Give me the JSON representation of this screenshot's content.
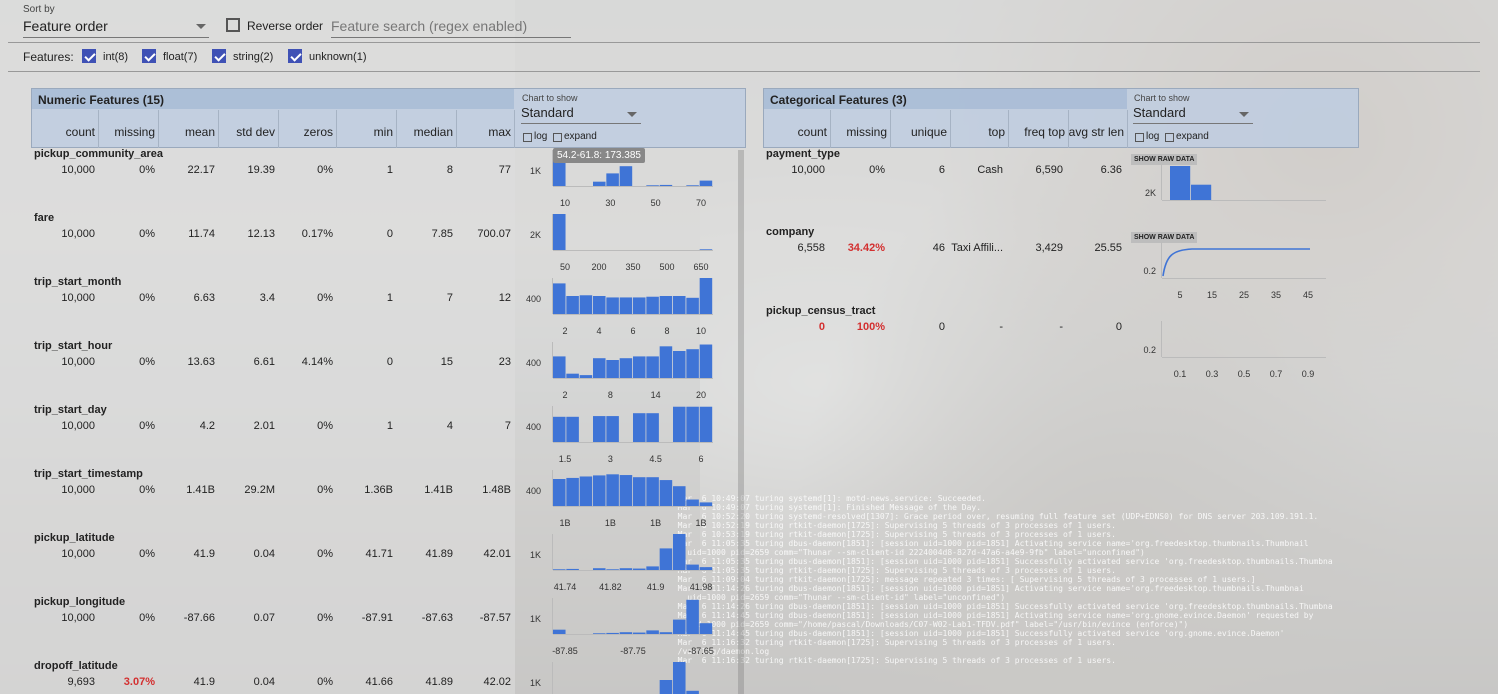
{
  "controls": {
    "sort_label": "Sort by",
    "sort_value": "Feature order",
    "reverse_label": "Reverse order",
    "search_placeholder": "Feature search (regex enabled)",
    "features_label": "Features:",
    "feature_types": [
      {
        "label": "int(8)",
        "checked": true
      },
      {
        "label": "float(7)",
        "checked": true
      },
      {
        "label": "string(2)",
        "checked": true
      },
      {
        "label": "unknown(1)",
        "checked": true
      }
    ]
  },
  "numeric": {
    "title": "Numeric Features (15)",
    "chart_label": "Chart to show",
    "chart_value": "Standard",
    "log_label": "log",
    "expand_label": "expand",
    "columns": [
      "count",
      "missing",
      "mean",
      "std dev",
      "zeros",
      "min",
      "median",
      "max"
    ],
    "tooltip": "54.2-61.8: 173.385",
    "rows": [
      {
        "name": "pickup_community_area",
        "count": "10,000",
        "missing": "0%",
        "mean": "22.17",
        "std": "19.39",
        "zeros": "0%",
        "min": "1",
        "median": "8",
        "max": "77",
        "missing_red": false,
        "ylabel": "1K",
        "ticks": [
          "10",
          "30",
          "50",
          "70"
        ],
        "bars": [
          0.95,
          0,
          0,
          0.12,
          0.35,
          0.55,
          0,
          0.02,
          0.03,
          0,
          0.02,
          0.15
        ]
      },
      {
        "name": "fare",
        "count": "10,000",
        "missing": "0%",
        "mean": "11.74",
        "std": "12.13",
        "zeros": "0.17%",
        "min": "0",
        "median": "7.85",
        "max": "700.07",
        "missing_red": false,
        "ylabel": "2K",
        "ticks": [
          "50",
          "200",
          "350",
          "500",
          "650"
        ],
        "bars": [
          1,
          0,
          0,
          0,
          0,
          0,
          0,
          0,
          0,
          0,
          0,
          0.02
        ]
      },
      {
        "name": "trip_start_month",
        "count": "10,000",
        "missing": "0%",
        "mean": "6.63",
        "std": "3.4",
        "zeros": "0%",
        "min": "1",
        "median": "7",
        "max": "12",
        "missing_red": false,
        "ylabel": "400",
        "ticks": [
          "2",
          "4",
          "6",
          "8",
          "10"
        ],
        "bars": [
          0.85,
          0.5,
          0.52,
          0.5,
          0.46,
          0.46,
          0.46,
          0.48,
          0.5,
          0.5,
          0.45,
          1
        ]
      },
      {
        "name": "trip_start_hour",
        "count": "10,000",
        "missing": "0%",
        "mean": "13.63",
        "std": "6.61",
        "zeros": "4.14%",
        "min": "0",
        "median": "15",
        "max": "23",
        "missing_red": false,
        "ylabel": "400",
        "ticks": [
          "2",
          "8",
          "14",
          "20"
        ],
        "bars": [
          0.6,
          0.12,
          0.08,
          0.55,
          0.5,
          0.55,
          0.6,
          0.6,
          0.88,
          0.75,
          0.8,
          0.93
        ]
      },
      {
        "name": "trip_start_day",
        "count": "10,000",
        "missing": "0%",
        "mean": "4.2",
        "std": "2.01",
        "zeros": "0%",
        "min": "1",
        "median": "4",
        "max": "7",
        "missing_red": false,
        "ylabel": "400",
        "ticks": [
          "1.5",
          "3",
          "4.5",
          "6"
        ],
        "bars": [
          0.7,
          0.7,
          0,
          0.72,
          0.72,
          0,
          0.8,
          0.8,
          0,
          0.98,
          0.98,
          0.98
        ]
      },
      {
        "name": "trip_start_timestamp",
        "count": "10,000",
        "missing": "0%",
        "mean": "1.41B",
        "std": "29.2M",
        "zeros": "0%",
        "min": "1.36B",
        "median": "1.41B",
        "max": "1.48B",
        "missing_red": false,
        "ylabel": "400",
        "ticks": [
          "1B",
          "1B",
          "1B",
          "1B"
        ],
        "bars": [
          0.75,
          0.78,
          0.82,
          0.85,
          0.88,
          0.86,
          0.8,
          0.8,
          0.72,
          0.55,
          0.18,
          0.1
        ]
      },
      {
        "name": "pickup_latitude",
        "count": "10,000",
        "missing": "0%",
        "mean": "41.9",
        "std": "0.04",
        "zeros": "0%",
        "min": "41.71",
        "median": "41.89",
        "max": "42.01",
        "missing_red": false,
        "ylabel": "1K",
        "ticks": [
          "41.74",
          "41.82",
          "41.9",
          "41.98"
        ],
        "bars": [
          0.02,
          0.03,
          0,
          0.05,
          0.02,
          0.05,
          0.04,
          0.1,
          0.6,
          1,
          0.15,
          0.08
        ]
      },
      {
        "name": "pickup_longitude",
        "count": "10,000",
        "missing": "0%",
        "mean": "-87.66",
        "std": "0.07",
        "zeros": "0%",
        "min": "-87.91",
        "median": "-87.63",
        "max": "-87.57",
        "missing_red": false,
        "ylabel": "1K",
        "ticks": [
          "-87.85",
          "-87.75",
          "-87.65"
        ],
        "bars": [
          0.12,
          0,
          0,
          0.02,
          0.03,
          0.05,
          0.04,
          0.1,
          0.05,
          0.4,
          0.95,
          0.3
        ]
      },
      {
        "name": "dropoff_latitude",
        "count": "9,693",
        "missing": "3.07%",
        "mean": "41.9",
        "std": "0.04",
        "zeros": "0%",
        "min": "41.66",
        "median": "41.89",
        "max": "42.02",
        "missing_red": true,
        "ylabel": "1K",
        "ticks": [],
        "bars": [
          0,
          0,
          0,
          0,
          0,
          0,
          0,
          0,
          0.5,
          1,
          0.2,
          0.05
        ]
      }
    ]
  },
  "categorical": {
    "title": "Categorical Features (3)",
    "chart_label": "Chart to show",
    "chart_value": "Standard",
    "log_label": "log",
    "expand_label": "expand",
    "columns": [
      "count",
      "missing",
      "unique",
      "top",
      "freq top",
      "avg str len"
    ],
    "raw_button": "SHOW RAW DATA",
    "rows": [
      {
        "name": "payment_type",
        "count": "10,000",
        "missing": "0%",
        "unique": "6",
        "top": "Cash",
        "freq_top": "6,590",
        "avg_len": "6.36",
        "count_red": false,
        "missing_red": false,
        "ylabel": "2K",
        "ticks": [],
        "bars": [
          0,
          1,
          0.45,
          0,
          0,
          0,
          0,
          0
        ],
        "kind": "bar",
        "raw": true
      },
      {
        "name": "company",
        "count": "6,558",
        "missing": "34.42%",
        "unique": "46",
        "top": "Taxi Affili...",
        "freq_top": "3,429",
        "avg_len": "25.55",
        "count_red": false,
        "missing_red": true,
        "ylabel": "0.2",
        "ticks": [
          "5",
          "15",
          "25",
          "35",
          "45"
        ],
        "kind": "cdf",
        "raw": true
      },
      {
        "name": "pickup_census_tract",
        "count": "0",
        "missing": "100%",
        "unique": "0",
        "top": "-",
        "freq_top": "-",
        "avg_len": "0",
        "count_red": true,
        "missing_red": true,
        "ylabel": "0.2",
        "ticks": [
          "0.1",
          "0.3",
          "0.5",
          "0.7",
          "0.9"
        ],
        "kind": "empty",
        "raw": false
      }
    ]
  },
  "terminal": {
    "lines": [
      "  Mar  6 10:49:07 turing systemd[1]: motd-news.service: Succeeded.",
      "  Mar  6 10:49:07 turing systemd[1]: Finished Message of the Day.",
      "  Mar  6 10:52:20 turing systemd-resolved[1307]: Grace period over, resuming full feature set (UDP+EDNS0) for DNS server 203.109.191.1.",
      "  Mar  6 10:52:19 turing rtkit-daemon[1725]: Supervising 5 threads of 3 processes of 1 users.",
      "  Mar  6 10:53:19 turing rtkit-daemon[1725]: Supervising 5 threads of 3 processes of 1 users.",
      "  Mar  6 11:05:35 turing dbus-daemon[1851]: [session uid=1000 pid=1851] Activating service name='org.freedesktop.thumbnails.Thumbnail",
      "    uid=1000 pid=2659 comm=\"Thunar --sm-client-id 2224004d8-827d-47a6-a4e9-9fb\" label=\"unconfined\")",
      "  Mar  6 11:05:35 turing dbus-daemon[1851]: [session uid=1000 pid=1851] Successfully activated service 'org.freedesktop.thumbnails.Thumbna",
      "  Mar  6 11:05:35 turing rtkit-daemon[1725]: Supervising 5 threads of 3 processes of 1 users.",
      "  Mar  6 11:09:04 turing rtkit-daemon[1725]: message repeated 3 times: [ Supervising 5 threads of 3 processes of 1 users.]",
      "  Mar  6 11:14:26 turing dbus-daemon[1851]: [session uid=1000 pid=1851] Activating service name='org.freedesktop.thumbnails.Thumbnai",
      "    uid=1000 pid=2659 comm=\"Thunar --sm-client-id\" label=\"unconfined\")",
      "  Mar  6 11:14:26 turing dbus-daemon[1851]: [session uid=1000 pid=1851] Successfully activated service 'org.freedesktop.thumbnails.Thumbna",
      "  Mar  6 11:14:45 turing dbus-daemon[1851]: [session uid=1000 pid=1851] Activating service name='org.gnome.evince.Daemon' requested by",
      "    uid=1000 pid=2659 comm=\"/home/pascal/Downloads/C07-W02-Lab1-TFDV.pdf\" label=\"/usr/bin/evince (enforce)\")",
      "  Mar  6 11:14:45 turing dbus-daemon[1851]: [session uid=1000 pid=1851] Successfully activated service 'org.gnome.evince.Daemon'",
      "  Mar  6 11:16:32 turing rtkit-daemon[1725]: Supervising 5 threads of 3 processes of 1 users.",
      "",
      "",
      "",
      "  /var/log/daemon.log",
      "  Mar  6 11:16:32 turing rtkit-daemon[1725]: Supervising 5 threads of 3 processes of 1 users."
    ]
  }
}
